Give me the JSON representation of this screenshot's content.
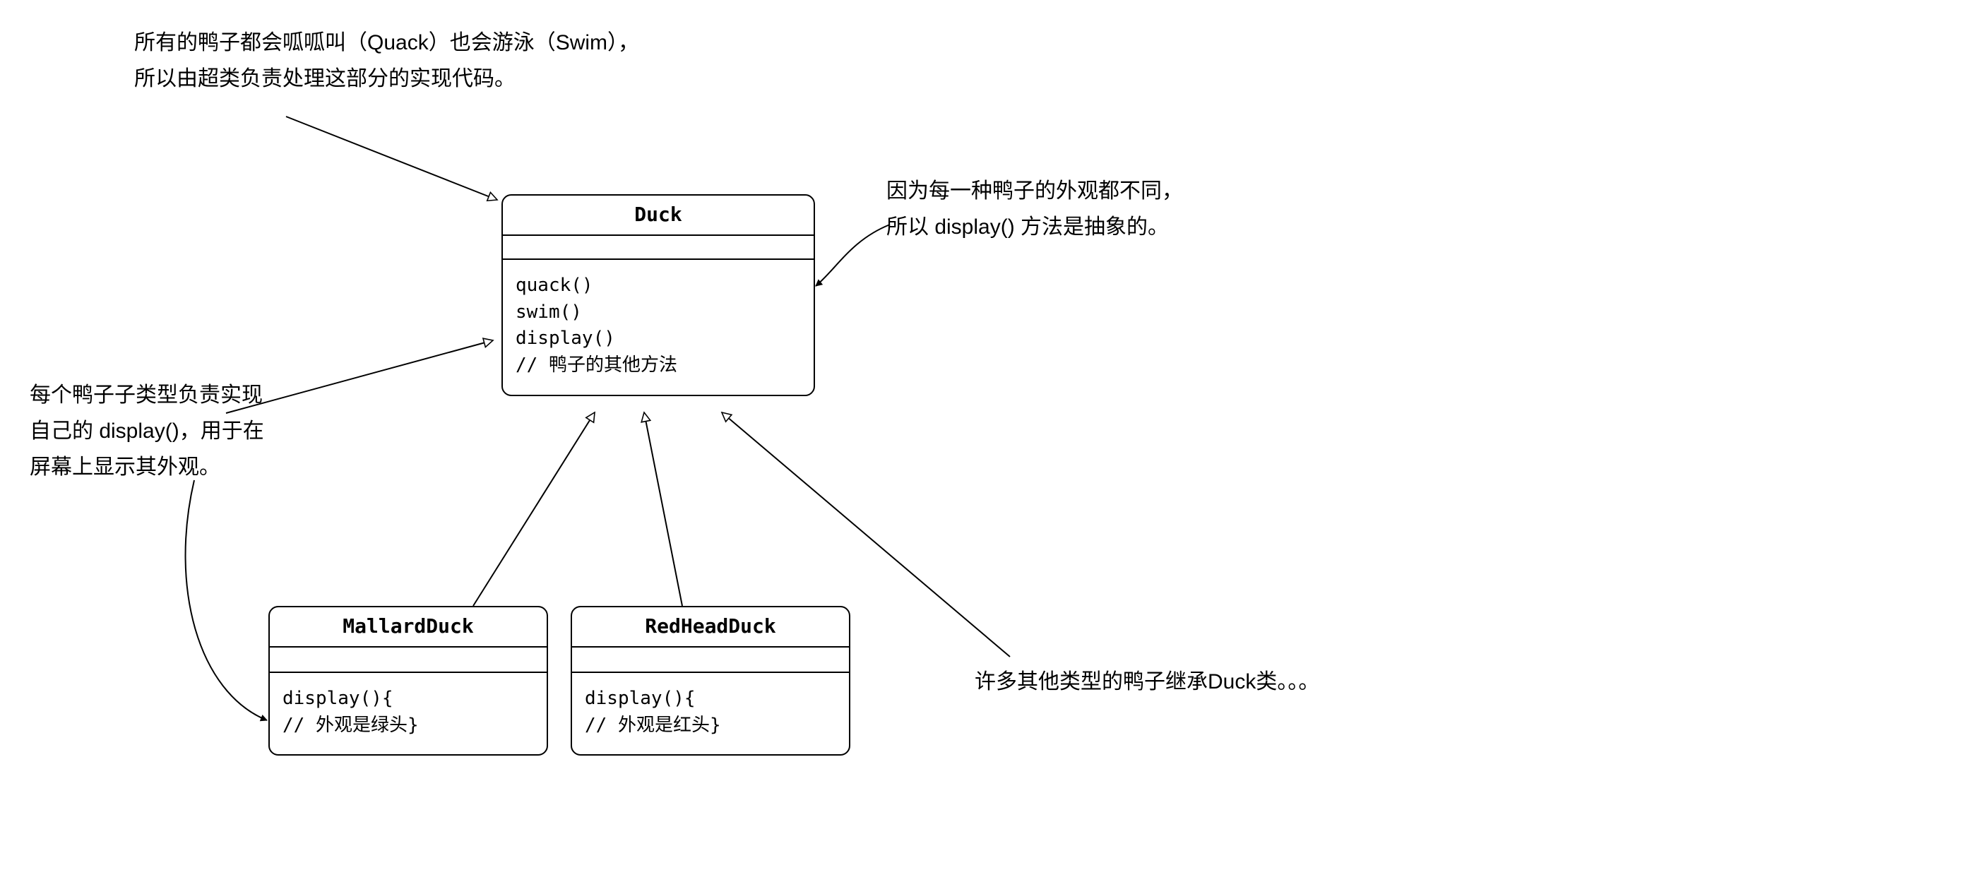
{
  "annotations": {
    "top": "所有的鸭子都会呱呱叫（Quack）也会游泳（Swim），\n所以由超类负责处理这部分的实现代码。",
    "right": "因为每一种鸭子的外观都不同，\n所以 display() 方法是抽象的。",
    "left": "每个鸭子子类型负责实现\n自己的 display()，用于在\n屏幕上显示其外观。",
    "br": "许多其他类型的鸭子继承Duck类。。。"
  },
  "classes": {
    "duck": {
      "name": "Duck",
      "methods": "quack()\nswim()\ndisplay()\n// 鸭子的其他方法"
    },
    "mallard": {
      "name": "MallardDuck",
      "methods": "display(){\n// 外观是绿头}"
    },
    "redhead": {
      "name": "RedHeadDuck",
      "methods": "display(){\n// 外观是红头}"
    }
  }
}
